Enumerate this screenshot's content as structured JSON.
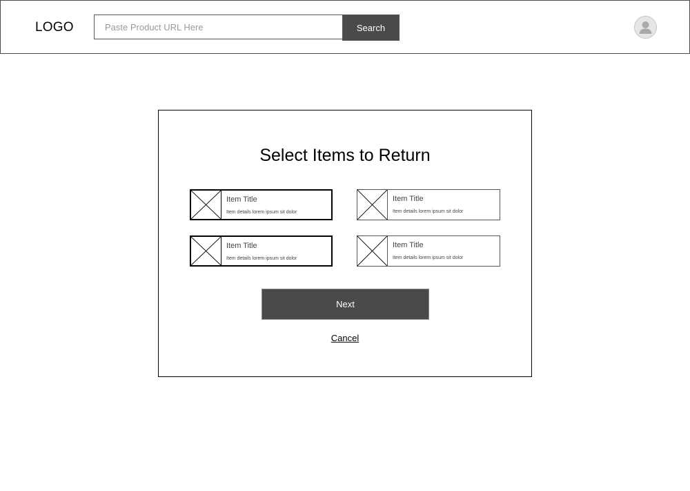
{
  "header": {
    "logo": "LOGO",
    "search": {
      "placeholder": "Paste Product URL Here",
      "value": "",
      "button_label": "Search"
    },
    "avatar_icon": "user-avatar-icon"
  },
  "modal": {
    "title": "Select Items to Return",
    "items": [
      {
        "title": "Item Title",
        "details": "Item details lorem ipsum sit dolor",
        "selected": true,
        "image_icon": "image-placeholder-icon"
      },
      {
        "title": "Item Title",
        "details": "Item details lorem ipsum sit dolor",
        "selected": false,
        "image_icon": "image-placeholder-icon"
      },
      {
        "title": "Item Title",
        "details": "Item details lorem ipsum sit dolor",
        "selected": true,
        "image_icon": "image-placeholder-icon"
      },
      {
        "title": "Item Title",
        "details": "Item details lorem ipsum sit dolor",
        "selected": false,
        "image_icon": "image-placeholder-icon"
      }
    ],
    "next_label": "Next",
    "cancel_label": "Cancel"
  },
  "colors": {
    "button_bg": "#4a4a4a",
    "button_text": "#ffffff",
    "border": "#555555",
    "placeholder_text": "#9a9a9a"
  }
}
